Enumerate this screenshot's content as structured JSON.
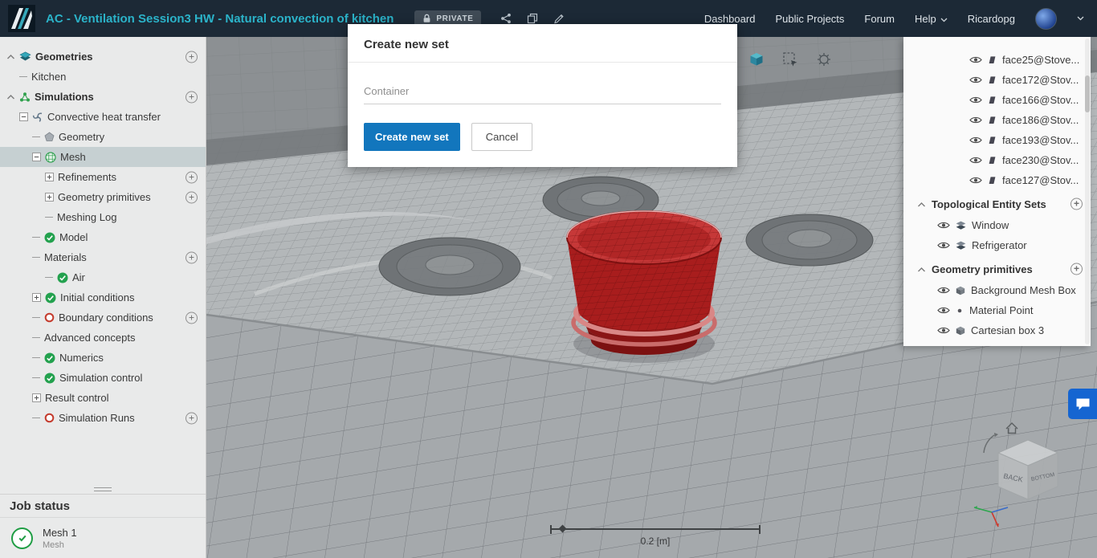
{
  "header": {
    "title": "AC - Ventilation Session3 HW - Natural convection of kitchen",
    "private_label": "PRIVATE",
    "icons": [
      "share-icon",
      "duplicate-icon",
      "edit-icon"
    ],
    "nav": [
      {
        "label": "Dashboard"
      },
      {
        "label": "Public Projects"
      },
      {
        "label": "Forum"
      },
      {
        "label": "Help",
        "caret": true
      }
    ],
    "user": "Ricardopg"
  },
  "sidebar": {
    "tree": [
      {
        "label": "Geometries",
        "level": 0,
        "caret": true,
        "icon": "geometries",
        "add": true
      },
      {
        "label": "Kitchen",
        "level": 1,
        "dash": true
      },
      {
        "label": "Simulations",
        "level": 0,
        "caret": true,
        "icon": "simulations",
        "add": true
      },
      {
        "label": "Convective heat transfer",
        "level": 1,
        "expander": "minus",
        "icon": "heat-transfer"
      },
      {
        "label": "Geometry",
        "level": 2,
        "dash": true,
        "icon": "geometry-shape"
      },
      {
        "label": "Mesh",
        "level": 2,
        "expander": "minus",
        "icon": "mesh",
        "selected": true
      },
      {
        "label": "Refinements",
        "level": 3,
        "expander": "plus",
        "add": true
      },
      {
        "label": "Geometry primitives",
        "level": 3,
        "expander": "plus",
        "add": true
      },
      {
        "label": "Meshing Log",
        "level": 3,
        "dash": true
      },
      {
        "label": "Model",
        "level": 2,
        "dash": true,
        "icon": "check-circle"
      },
      {
        "label": "Materials",
        "level": 2,
        "dash": true,
        "add": true
      },
      {
        "label": "Air",
        "level": 3,
        "dash": true,
        "icon": "check-circle"
      },
      {
        "label": "Initial conditions",
        "level": 2,
        "expander": "plus",
        "icon": "check-circle"
      },
      {
        "label": "Boundary conditions",
        "level": 2,
        "dash": true,
        "icon": "pending-circle",
        "add": true
      },
      {
        "label": "Advanced concepts",
        "level": 2,
        "dash": true
      },
      {
        "label": "Numerics",
        "level": 2,
        "dash": true,
        "icon": "check-circle"
      },
      {
        "label": "Simulation control",
        "level": 2,
        "dash": true,
        "icon": "check-circle"
      },
      {
        "label": "Result control",
        "level": 2,
        "expander": "plus"
      },
      {
        "label": "Simulation Runs",
        "level": 2,
        "dash": true,
        "icon": "pending-circle",
        "add": true
      }
    ],
    "job_status": {
      "header": "Job status",
      "job_title": "Mesh 1",
      "job_subtitle": "Mesh"
    }
  },
  "modal": {
    "title": "Create new set",
    "input_value": "Container",
    "primary_label": "Create new set",
    "cancel_label": "Cancel"
  },
  "right_panel": {
    "faces": [
      "face25@Stove...",
      "face172@Stov...",
      "face166@Stov...",
      "face186@Stov...",
      "face193@Stov...",
      "face230@Stov...",
      "face127@Stov..."
    ],
    "sections": [
      {
        "title": "Topological Entity Sets",
        "add": true,
        "items": [
          {
            "label": "Window",
            "icon": "set-layers"
          },
          {
            "label": "Refrigerator",
            "icon": "set-layers"
          }
        ]
      },
      {
        "title": "Geometry primitives",
        "add": true,
        "items": [
          {
            "label": "Background Mesh Box",
            "icon": "prim-box"
          },
          {
            "label": "Material Point",
            "icon": "prim-point"
          },
          {
            "label": "Cartesian box 3",
            "icon": "prim-box"
          }
        ]
      }
    ]
  },
  "viewport": {
    "tools": [
      "primitive-cube-icon",
      "box-select-icon",
      "mesh-settings-icon"
    ],
    "scale_label": "0.2 [m]",
    "nav_cube": {
      "back": "BACK",
      "bottom": "BOTTOM"
    }
  },
  "colors": {
    "accent": "#2bb3c9",
    "primary_button": "#1276bd",
    "selection": "#c6d0d2",
    "highlight_red": "#c63838",
    "header_bg": "#1c2936"
  }
}
